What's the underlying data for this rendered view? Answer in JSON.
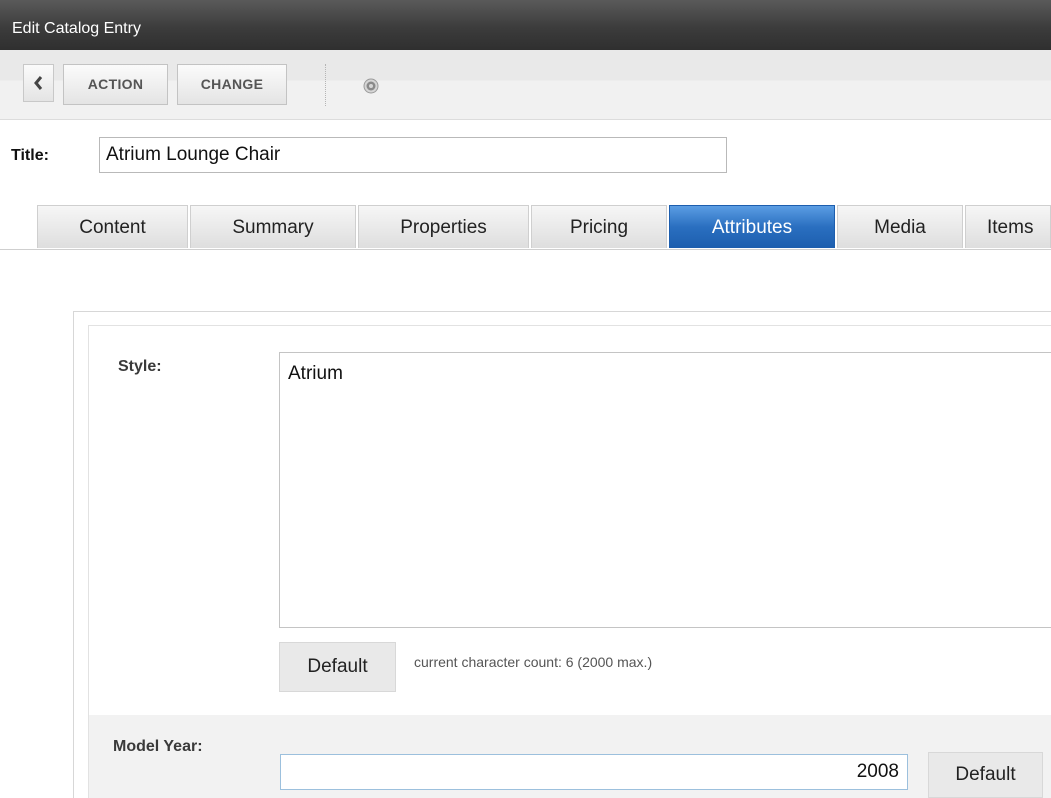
{
  "window": {
    "title": "Edit Catalog Entry"
  },
  "toolbar": {
    "back_icon": "chevron-left-icon",
    "action_label": "ACTION",
    "change_label": "CHANGE",
    "help_icon": "help-icon"
  },
  "entry": {
    "title_label": "Title:",
    "title_value": "Atrium Lounge Chair"
  },
  "tabs": [
    {
      "label": "Content",
      "active": false
    },
    {
      "label": "Summary",
      "active": false
    },
    {
      "label": "Properties",
      "active": false
    },
    {
      "label": "Pricing",
      "active": false
    },
    {
      "label": "Attributes",
      "active": true
    },
    {
      "label": "Media",
      "active": false
    },
    {
      "label": "Items",
      "active": false
    }
  ],
  "attributes": {
    "style": {
      "label": "Style:",
      "value": "Atrium",
      "default_label": "Default",
      "char_count_text": "current character count: 6  (2000 max.)"
    },
    "model_year": {
      "label": "Model Year:",
      "value": "2008",
      "default_label": "Default"
    }
  },
  "colors": {
    "active_tab": "#2a6fc0",
    "titlebar": "#3c3c3c"
  }
}
